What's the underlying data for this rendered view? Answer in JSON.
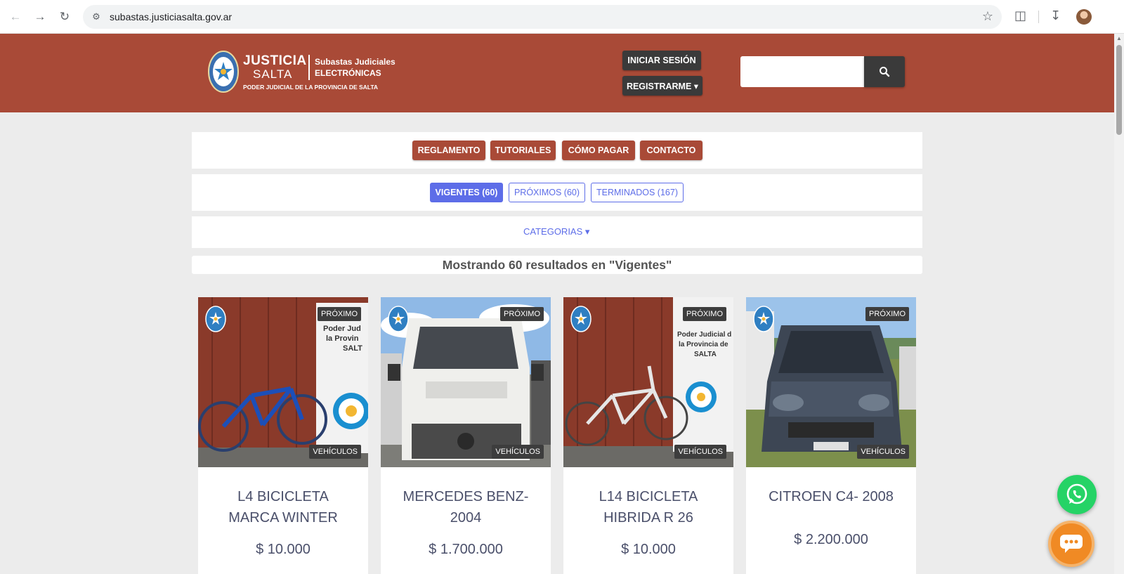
{
  "browser": {
    "url": "subastas.justiciasalta.gov.ar"
  },
  "header": {
    "logo": {
      "line1": "JUSTICIA",
      "line2": "SALTA",
      "subtitle1": "Subastas Judiciales",
      "subtitle2": "ELECTRÓNICAS",
      "tagline": "PODER JUDICIAL DE LA PROVINCIA DE SALTA"
    },
    "login_label": "INICIAR SESIÓN",
    "register_label": "REGISTRARME ▾",
    "search_placeholder": ""
  },
  "menu": {
    "items": [
      "REGLAMENTO",
      "TUTORIALES",
      "CÓMO PAGAR",
      "CONTACTO"
    ]
  },
  "tabs": {
    "items": [
      "VIGENTES (60)",
      "PRÓXIMOS (60)",
      "TERMINADOS (167)"
    ],
    "active": "VIGENTES (60)"
  },
  "categories_label": "CATEGORIAS ▾",
  "results_text": "Mostrando 60 resultados en \"Vigentes\"",
  "cards": [
    {
      "status": "PRÓXIMO",
      "category": "VEHÍCULOS",
      "title": "L4 BICICLETA MARCA WINTER",
      "price": "$ 10.000"
    },
    {
      "status": "PRÓXIMO",
      "category": "VEHÍCULOS",
      "title": "MERCEDES BENZ- 2004",
      "price": "$ 1.700.000"
    },
    {
      "status": "PRÓXIMO",
      "category": "VEHÍCULOS",
      "title": "L14 BICICLETA HIBRIDA R 26",
      "price": "$ 10.000"
    },
    {
      "status": "PRÓXIMO",
      "category": "VEHÍCULOS",
      "title": "CITROEN C4- 2008",
      "price": "$ 2.200.000"
    }
  ],
  "colors": {
    "header": "#a94a37",
    "accent": "#5d6de8",
    "dark_button": "#3a3a3a",
    "whatsapp": "#25d366",
    "chat": "#f08a24"
  },
  "icons": [
    "back-icon",
    "forward-icon",
    "reload-icon",
    "site-info-icon",
    "star-icon",
    "extensions-icon",
    "download-icon",
    "search-icon",
    "whatsapp-icon",
    "chat-icon"
  ]
}
